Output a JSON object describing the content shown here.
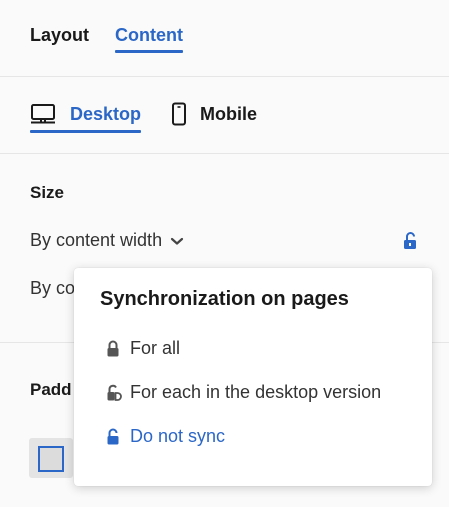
{
  "tabs": [
    {
      "label": "Layout",
      "active": false
    },
    {
      "label": "Content",
      "active": true
    }
  ],
  "devices": [
    {
      "label": "Desktop",
      "icon": "desktop-icon",
      "active": true
    },
    {
      "label": "Mobile",
      "icon": "mobile-icon",
      "active": false
    }
  ],
  "size": {
    "label": "Size",
    "selected": "By content width",
    "second_option_partial": "By co",
    "lock_icon": "unlock-icon"
  },
  "padding": {
    "label_partial": "Padd"
  },
  "sync_popover": {
    "title": "Synchronization on pages",
    "items": [
      {
        "label": "For all",
        "icon": "lock-icon",
        "active": false
      },
      {
        "label": "For each in the desktop version",
        "icon": "lock-device-icon",
        "active": false
      },
      {
        "label": "Do not sync",
        "icon": "unlock-icon",
        "active": true
      }
    ]
  },
  "colors": {
    "accent": "#2b67c7",
    "text": "#1a1a1a",
    "background": "#fafafa",
    "divider": "#e6e6e6"
  }
}
